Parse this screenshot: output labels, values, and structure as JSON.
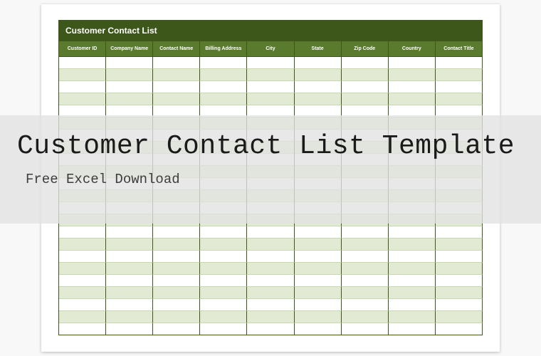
{
  "sheet": {
    "title": "Customer Contact List",
    "columns": [
      "Customer ID",
      "Company Name",
      "Contact Name",
      "Billing Address",
      "City",
      "State",
      "Zip Code",
      "Country",
      "Contact Title"
    ],
    "row_count": 23
  },
  "overlay": {
    "title": "Customer Contact List Template",
    "subtitle": "Free Excel Download"
  }
}
